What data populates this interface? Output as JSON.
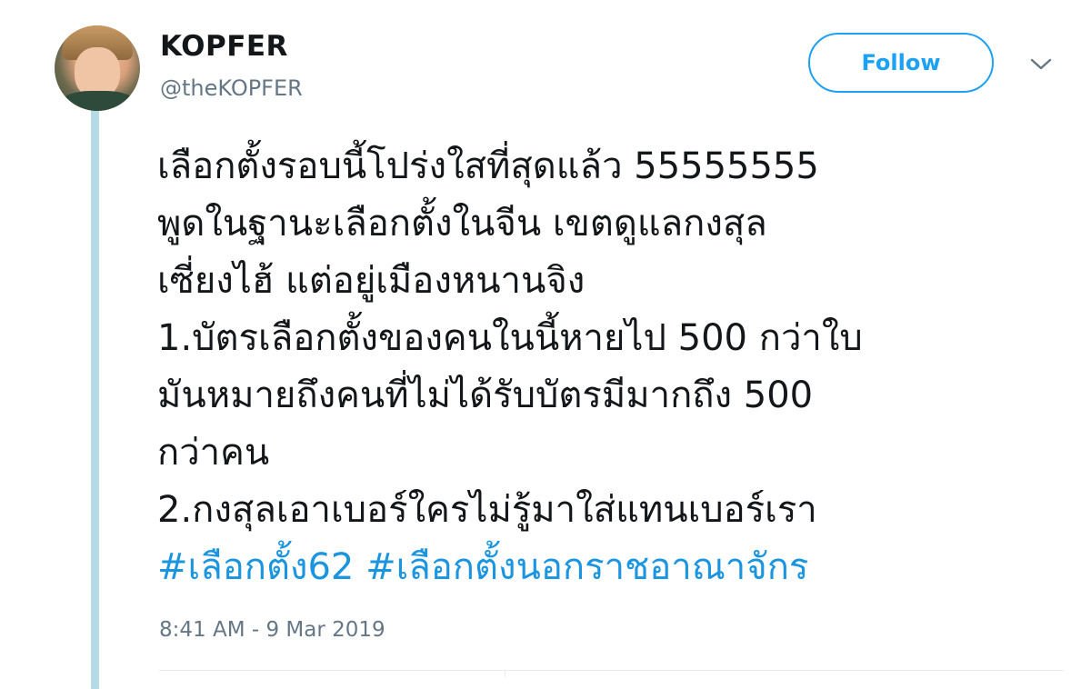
{
  "author": {
    "display_name": "KOPFER",
    "handle": "@theKOPFER",
    "avatar_icon": "profile-photo"
  },
  "follow_button": {
    "label": "Follow"
  },
  "more_menu": {
    "icon": "chevron-down-icon"
  },
  "tweet": {
    "lines": [
      "เลือกตั้งรอบนี้โปร่งใสที่สุดแล้ว 55555555",
      "พูดในฐานะเลือกตั้งในจีน เขตดูแลกงสุล",
      "เซี่ยงไฮ้ แต่อยู่เมืองหนานจิง",
      "1.บัตรเลือกตั้งของคนในนี้หายไป 500 กว่าใบ",
      "มันหมายถึงคนที่ไม่ได้รับบัตรมีมากถึง 500",
      "กว่าคน",
      "2.กงสุลเอาเบอร์ใครไม่รู้มาใส่แทนเบอร์เรา"
    ],
    "hashtags": [
      "#เลือกตั้ง62",
      "#เลือกตั้งนอกราชอาณาจักร"
    ],
    "timestamp": "8:41 AM - 9 Mar 2019"
  },
  "colors": {
    "accent": "#1da1f2",
    "hashtag": "#1b95e0",
    "thread_line": "#b4dbe6",
    "secondary_text": "#657786"
  }
}
